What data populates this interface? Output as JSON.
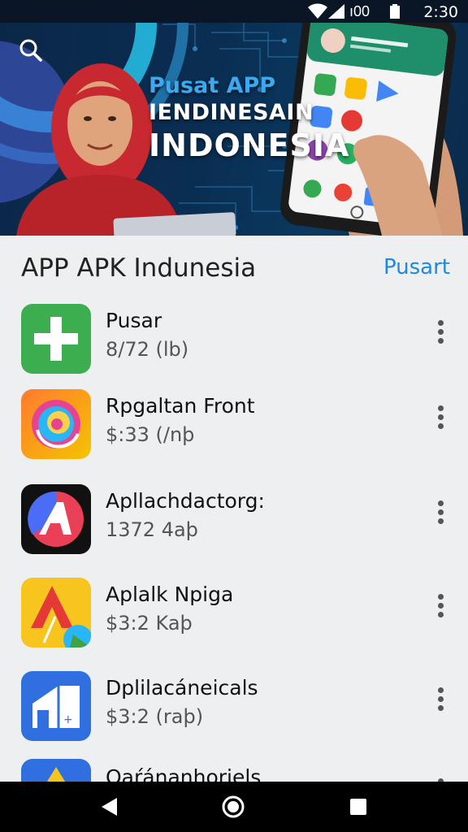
{
  "status_bar": {
    "time": "2:30",
    "signal_text": "ı00"
  },
  "banner": {
    "title_line1": "Pusat APP",
    "title_line2": "IENDINESAIN",
    "title_line3": "INDONESIA",
    "colors": {
      "background": "#0a2e52",
      "accent": "#3aa9f0"
    }
  },
  "section": {
    "title": "APP APK Indunesia",
    "link": "Pusart"
  },
  "apps": [
    {
      "name": "Pusar",
      "meta": "8/72 (lb)",
      "icon": "green-plus-icon"
    },
    {
      "name": "Rpgaltan Front",
      "meta": "$:33 (/nþ",
      "icon": "swirl-icon"
    },
    {
      "name": "Apllachdactorg:",
      "meta": "1372 4aþ",
      "icon": "letter-a-icon"
    },
    {
      "name": "Aplalk Npiga",
      "meta": "$3:2 Kaþ",
      "icon": "red-a-triangle-icon"
    },
    {
      "name": "Dplilacáneicals",
      "meta": "$3:2 (raþ)",
      "icon": "blue-house-icon"
    },
    {
      "name": "Oaŕánanhoriels",
      "meta": "",
      "icon": "yellow-triangle-icon"
    }
  ],
  "colors": {
    "link": "#1e88e5",
    "page_bg": "#eeeff0"
  }
}
